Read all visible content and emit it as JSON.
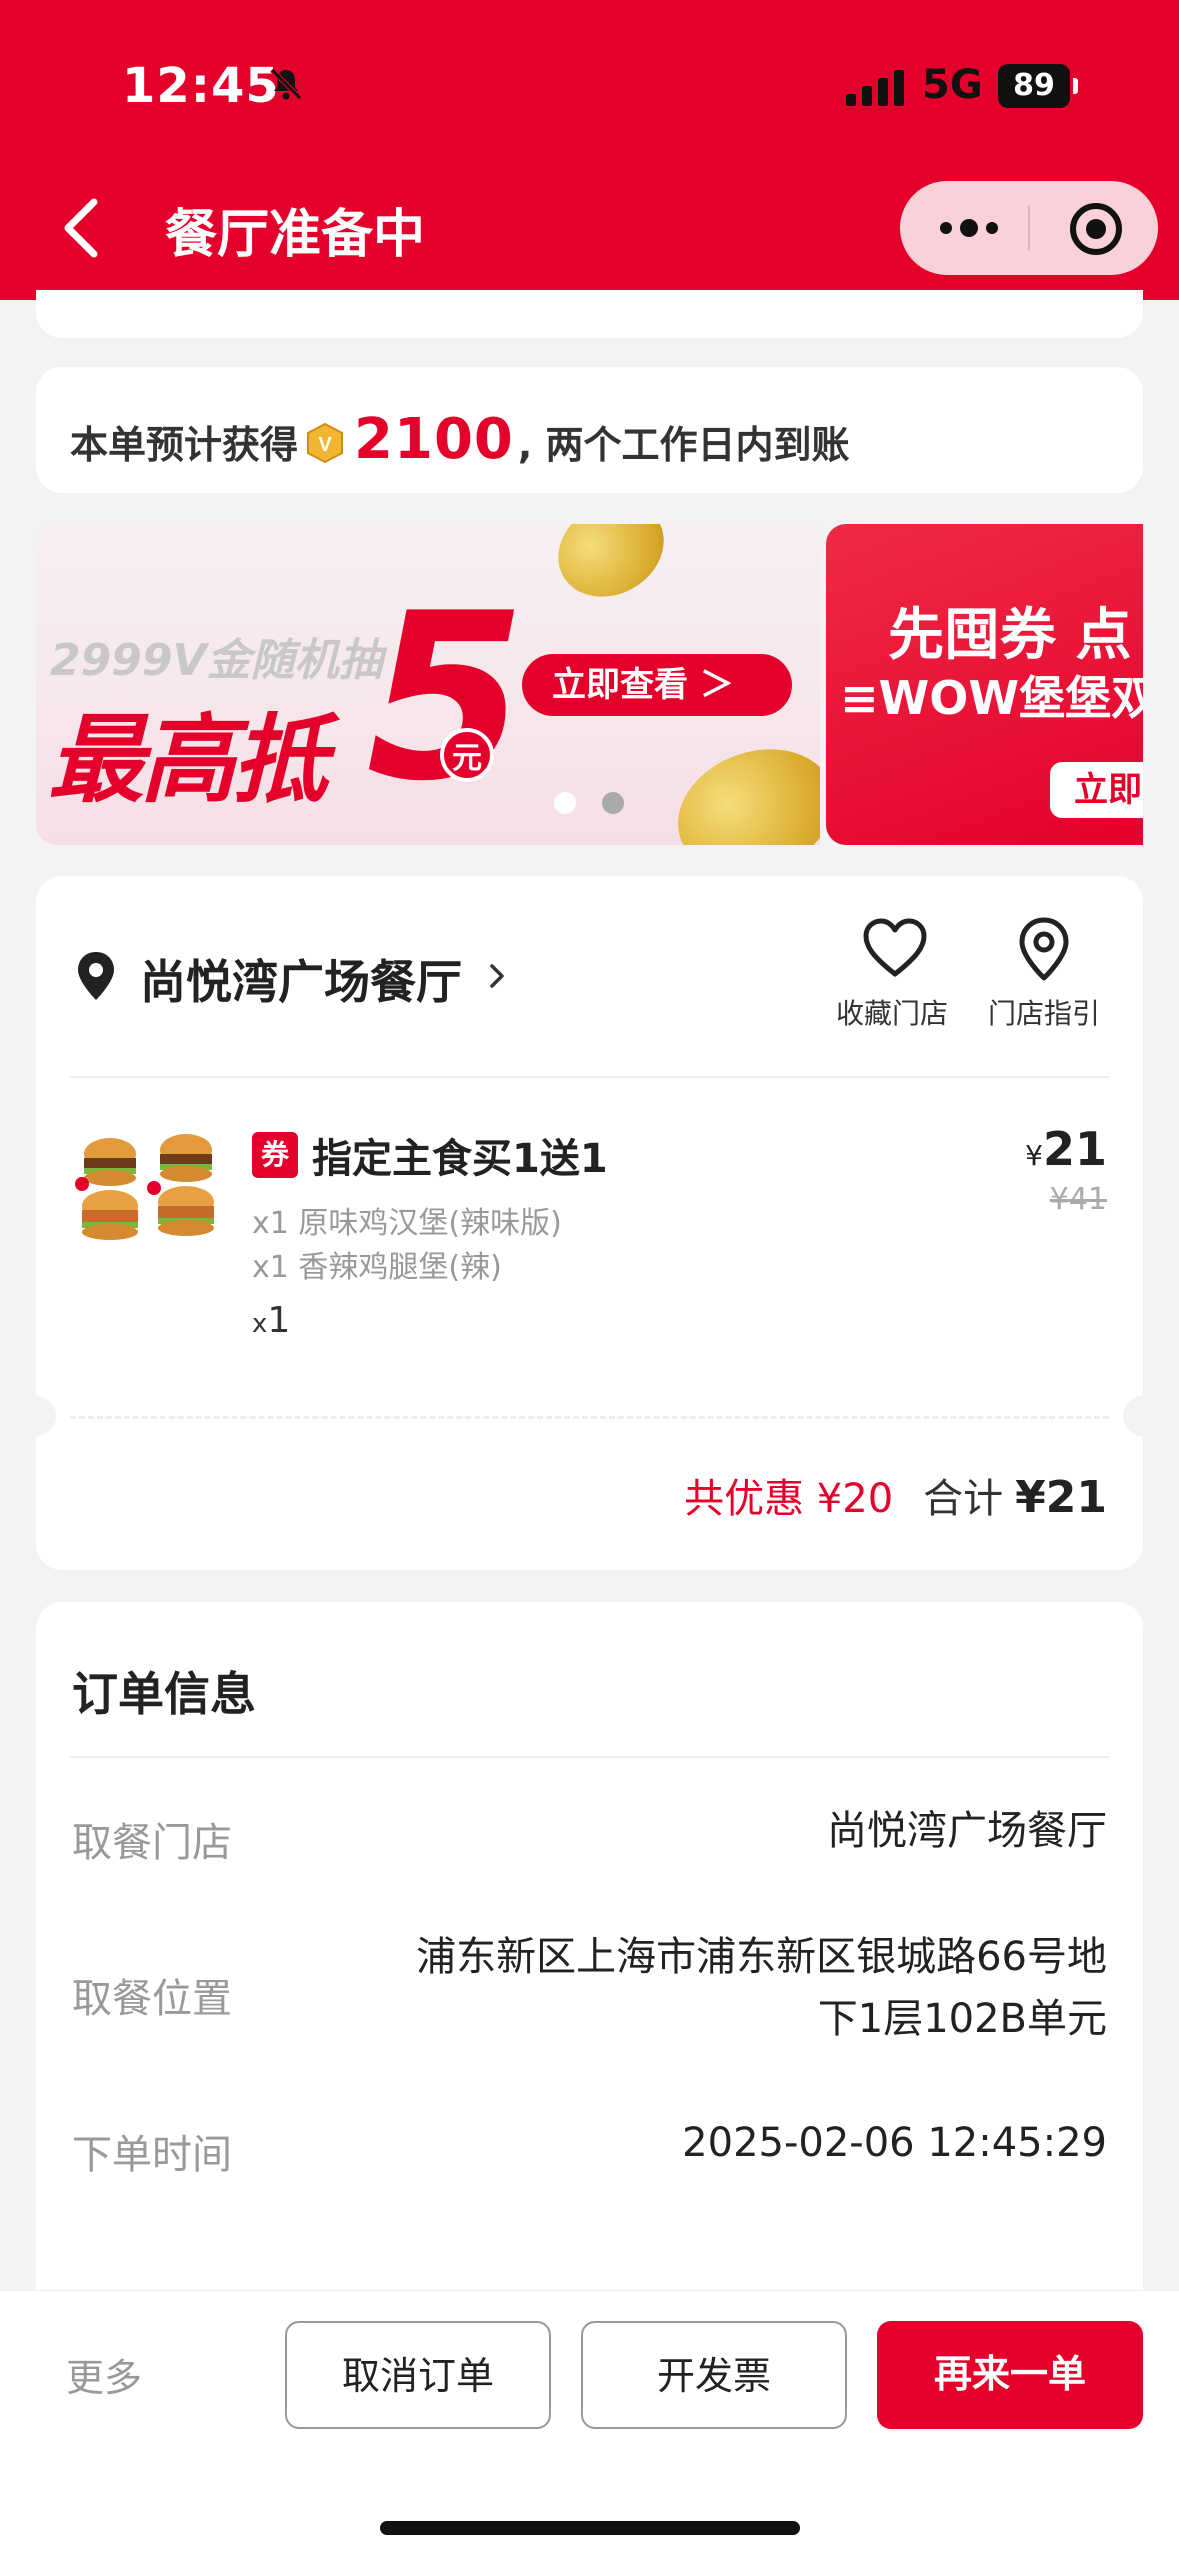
{
  "status_bar": {
    "time": "12:45",
    "network": "5G",
    "battery": "89"
  },
  "header": {
    "title": "餐厅准备中"
  },
  "points": {
    "prefix": "本单预计获得",
    "value": "2100",
    "suffix": ", 两个工作日内到账"
  },
  "banner": {
    "sub": "2999V金随机抽",
    "main": "最高抵",
    "five": "5",
    "yuan": "元",
    "button": "立即查看 ＞",
    "next_title": "先囤券 点",
    "next_sub": "≡WOW堡堡双",
    "next_button": "立即"
  },
  "store": {
    "name": "尚悦湾广场餐厅",
    "favorite_label": "收藏门店",
    "guide_label": "门店指引"
  },
  "order_item": {
    "badge": "券",
    "name": "指定主食买1送1",
    "sub_items": [
      "x1 原味鸡汉堡(辣味版)",
      "x1 香辣鸡腿堡(辣)"
    ],
    "qty_x": "x",
    "qty": "1",
    "price_currency": "¥",
    "price": "21",
    "original_price": "¥41"
  },
  "summary": {
    "discount": "共优惠 ¥20",
    "total_label": "合计",
    "total": "¥21"
  },
  "order_info": {
    "title": "订单信息",
    "rows": [
      {
        "label": "取餐门店",
        "value": "尚悦湾广场餐厅"
      },
      {
        "label": "取餐位置",
        "value_line1": "浦东新区上海市浦东新区银城路66号地",
        "value_line2": "下1层102B单元"
      },
      {
        "label": "下单时间",
        "value": "2025-02-06 12:45:29"
      }
    ]
  },
  "bottom_bar": {
    "more": "更多",
    "cancel": "取消订单",
    "invoice": "开发票",
    "reorder": "再来一单"
  },
  "colors": {
    "brand_red": "#e4002b",
    "background": "#f3f3f3"
  }
}
